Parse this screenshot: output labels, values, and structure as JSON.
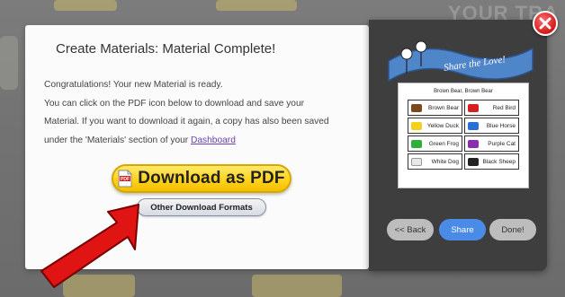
{
  "background": {
    "corner_text": "YOUR TRA"
  },
  "dialog": {
    "title": "Create Materials: Material Complete!",
    "message_lines": [
      "Congratulations! Your new Material is ready.",
      "You can click on the PDF icon below to download and save your",
      "Material. If you want to download it again, a copy has also been saved",
      "under the 'Materials' section of your "
    ],
    "dashboard_link": "Dashboard",
    "download_pdf_label": "Download as PDF",
    "other_formats_label": "Other Download Formats"
  },
  "preview": {
    "banner_text": "Share the Love!",
    "sheet_title": "Brown Bear, Brown Bear",
    "cells": [
      {
        "label": "Brown Bear",
        "color": "#7a4a1e"
      },
      {
        "label": "Red Bird",
        "color": "#d42020"
      },
      {
        "label": "Yellow Duck",
        "color": "#f2d21a"
      },
      {
        "label": "Blue Horse",
        "color": "#2a6fd6"
      },
      {
        "label": "Green Frog",
        "color": "#2fae3a"
      },
      {
        "label": "Purple Cat",
        "color": "#8a2cae"
      },
      {
        "label": "White Dog",
        "color": "#e8e8e8"
      },
      {
        "label": "Black Sheep",
        "color": "#222222"
      }
    ]
  },
  "nav": {
    "back_label": "<< Back",
    "share_label": "Share",
    "done_label": "Done!"
  },
  "icons": {
    "close": "close-icon",
    "pdf": "pdf-file-icon",
    "arrow": "red-arrow-icon"
  },
  "colors": {
    "accent_blue": "#4a8be8",
    "pdf_yellow": "#ffd31f",
    "close_red": "#d01a1a",
    "link_purple": "#6a3fb0"
  }
}
